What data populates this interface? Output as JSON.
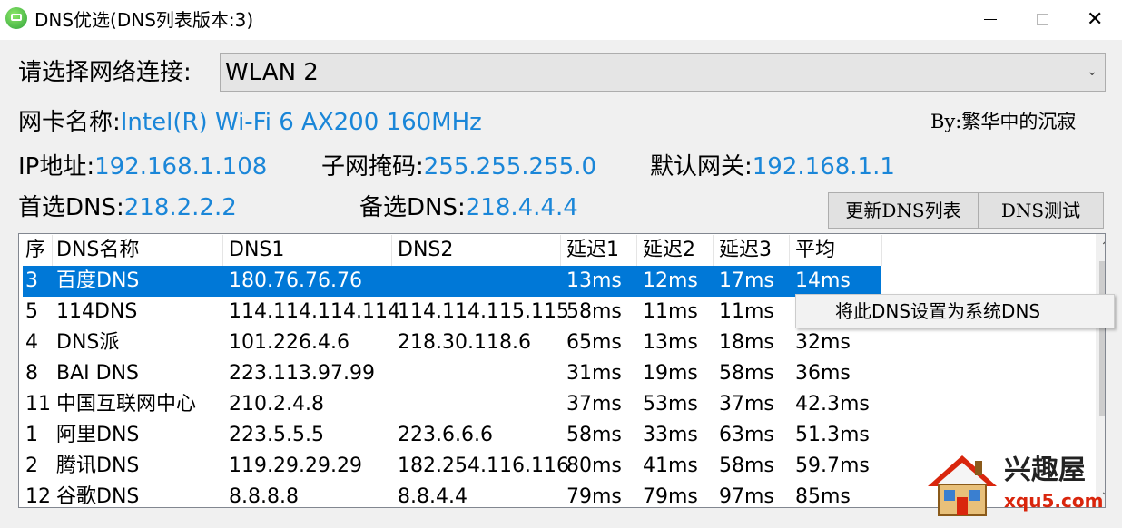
{
  "window": {
    "title": "DNS优选(DNS列表版本:3)"
  },
  "network": {
    "select_label": "请选择网络连接:",
    "selected": "WLAN 2",
    "adapter_label": "网卡名称:",
    "adapter_value": "Intel(R) Wi-Fi 6 AX200 160MHz",
    "author": "By:繁华中的沉寂",
    "ip_label": "IP地址:",
    "ip_value": "192.168.1.108",
    "mask_label": "子网掩码:",
    "mask_value": "255.255.255.0",
    "gateway_label": "默认网关:",
    "gateway_value": "192.168.1.1",
    "dns1_label": "首选DNS:",
    "dns1_value": "218.2.2.2",
    "dns2_label": "备选DNS:",
    "dns2_value": "218.4.4.4"
  },
  "buttons": {
    "update": "更新DNS列表",
    "test": "DNS测试"
  },
  "table": {
    "headers": [
      "序",
      "DNS名称",
      "DNS1",
      "DNS2",
      "延迟1",
      "延迟2",
      "延迟3",
      "平均"
    ],
    "rows": [
      [
        "3",
        "百度DNS",
        "180.76.76.76",
        "",
        "13ms",
        "12ms",
        "17ms",
        "14ms"
      ],
      [
        "5",
        "114DNS",
        "114.114.114.114",
        "114.114.115.115",
        "58ms",
        "11ms",
        "11ms",
        ""
      ],
      [
        "4",
        "DNS派",
        "101.226.4.6",
        "218.30.118.6",
        "65ms",
        "13ms",
        "18ms",
        "32ms"
      ],
      [
        "8",
        "BAI DNS",
        "223.113.97.99",
        "",
        "31ms",
        "19ms",
        "58ms",
        "36ms"
      ],
      [
        "11",
        "中国互联网中心",
        "210.2.4.8",
        "",
        "37ms",
        "53ms",
        "37ms",
        "42.3ms"
      ],
      [
        "1",
        "阿里DNS",
        "223.5.5.5",
        "223.6.6.6",
        "58ms",
        "33ms",
        "63ms",
        "51.3ms"
      ],
      [
        "2",
        "腾讯DNS",
        "119.29.29.29",
        "182.254.116.116",
        "80ms",
        "41ms",
        "58ms",
        "59.7ms"
      ],
      [
        "12",
        "谷歌DNS",
        "8.8.8.8",
        "8.8.4.4",
        "79ms",
        "79ms",
        "97ms",
        "85ms"
      ]
    ],
    "selected_row": 0
  },
  "context_menu": {
    "item": "将此DNS设置为系统DNS"
  },
  "watermark": {
    "text": "兴趣屋",
    "url": "xqu5.com"
  }
}
